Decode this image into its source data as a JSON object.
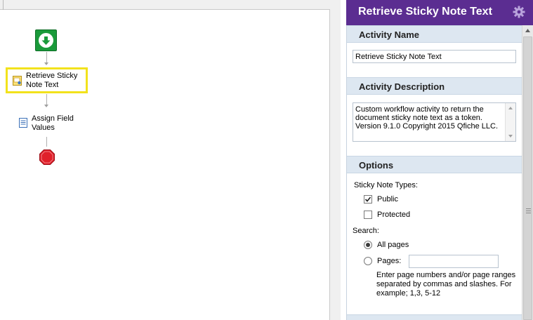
{
  "workflow": {
    "start_node": {
      "icon": "arrow-down-icon"
    },
    "activities": [
      {
        "label": "Retrieve Sticky Note Text",
        "label_lines": [
          "Retrieve Sticky",
          "Note Text"
        ],
        "icon": "sticky-note-icon",
        "selected": true
      },
      {
        "label": "Assign Field Values",
        "label_lines": [
          "Assign Field",
          "Values"
        ],
        "icon": "document-icon",
        "selected": false
      }
    ],
    "stop_node": {
      "icon": "stop-sign-icon"
    }
  },
  "panel": {
    "title": "Retrieve Sticky Note Text",
    "settings_icon": "gear-icon",
    "sections": {
      "activity_name": {
        "header": "Activity Name",
        "value": "Retrieve Sticky Note Text"
      },
      "activity_description": {
        "header": "Activity Description",
        "value": "Custom workflow activity to return the\ndocument sticky note text as a token.\nVersion 9.1.0  Copyright 2015 Qfiche LLC."
      },
      "options": {
        "header": "Options",
        "sticky_note_types_label": "Sticky Note Types:",
        "public": {
          "label": "Public",
          "checked": true
        },
        "protected": {
          "label": "Protected",
          "checked": false
        },
        "search_label": "Search:",
        "all_pages": {
          "label": "All pages",
          "selected": true
        },
        "pages": {
          "label": "Pages:",
          "selected": false,
          "value": ""
        },
        "hint": "Enter page numbers and/or page ranges separated by commas and slashes.  For example; 1,3, 5-12"
      }
    }
  },
  "colors": {
    "panel_header": "#5b2d91",
    "selection_border": "#f2e21c",
    "start_green": "#1a9a3a",
    "stop_red": "#e0202a",
    "section_header_bg": "#dde7f1"
  }
}
